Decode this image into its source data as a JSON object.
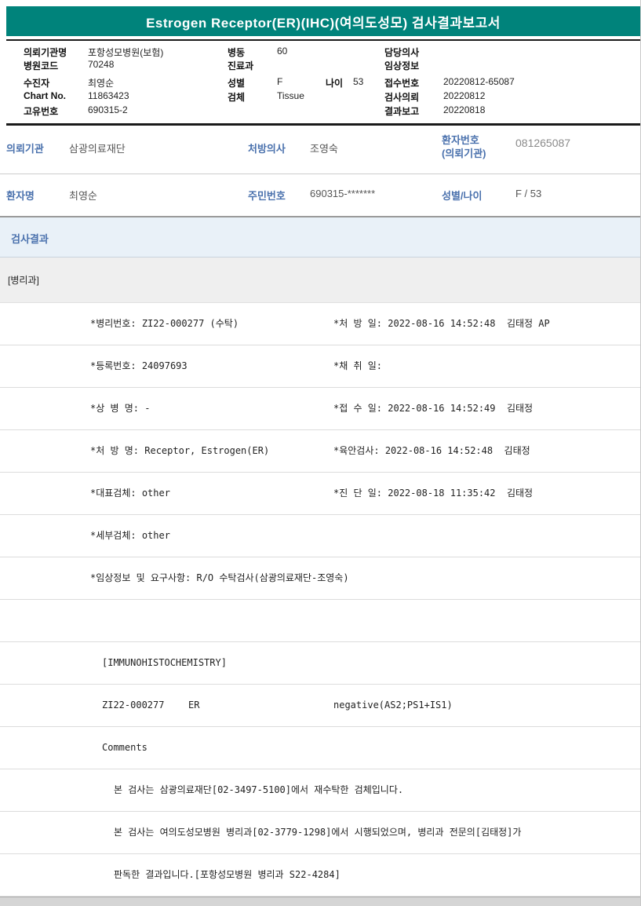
{
  "colors": {
    "banner_bg": "#00837B",
    "label_blue": "#4A71AD"
  },
  "banner": {
    "title": "Estrogen Receptor(ER)(IHC)(여의도성모) 검사결과보고서"
  },
  "info_box": {
    "col1": [
      {
        "label": "의뢰기관명",
        "value": "포항성모병원(보험)"
      },
      {
        "label": "병원코드",
        "value": "70248"
      },
      {
        "label": "수진자",
        "value": "최영순"
      },
      {
        "label": "Chart No.",
        "value": "11863423"
      },
      {
        "label": "고유번호",
        "value": "690315-2"
      }
    ],
    "col2": [
      {
        "label": "병동",
        "value": "60"
      },
      {
        "label": "진료과",
        "value": ""
      },
      {
        "label": "성별",
        "value": "F"
      },
      {
        "label": "검체",
        "value": "Tissue"
      }
    ],
    "age": {
      "label": "나이",
      "value": "53"
    },
    "col3": [
      {
        "label": "담당의사",
        "value": ""
      },
      {
        "label": "임상정보",
        "value": ""
      },
      {
        "label": "접수번호",
        "value": "20220812-65087"
      },
      {
        "label": "검사의뢰",
        "value": "20220812"
      },
      {
        "label": "결과보고",
        "value": "20220818"
      }
    ]
  },
  "referral": {
    "row1": {
      "agency_label": "의뢰기관",
      "agency_value": "삼광의료재단",
      "doctor_label": "처방의사",
      "doctor_value": "조영숙",
      "patient_no_label_line1": "환자번호",
      "patient_no_label_line2": "(의뢰기관)",
      "patient_no_value": "081265087"
    },
    "row2": {
      "name_label": "환자명",
      "name_value": "최영순",
      "rrn_label": "주민번호",
      "rrn_value": "690315-*******",
      "sexage_label": "성별/나이",
      "sexage_value": "F / 53"
    }
  },
  "results": {
    "section_title": "검사결과",
    "department": "[병리과]",
    "rows": [
      {
        "left": "*병리번호: ZI22-000277 (수탁)",
        "right": "*처 방 일: 2022-08-16 14:52:48  김태정 AP"
      },
      {
        "left": "*등록번호: 24097693",
        "right": "*채 취 일:"
      },
      {
        "left": "*상 병 명: -",
        "right": "*접 수 일: 2022-08-16 14:52:49  김태정"
      },
      {
        "left": "*처 방 명: Receptor, Estrogen(ER)",
        "right": "*육안검사: 2022-08-16 14:52:48  김태정"
      },
      {
        "left": "*대표검체: other",
        "right": "*진 단 일: 2022-08-18 11:35:42  김태정"
      },
      {
        "left": "*세부검체: other",
        "right": ""
      },
      {
        "left": "*임상정보 및 요구사항: R/O 수탁검사(삼광의료재단-조영숙)",
        "right": ""
      },
      {
        "left": "",
        "right": ""
      },
      {
        "left": "[IMMUNOHISTOCHEMISTRY]",
        "right": ""
      },
      {
        "c1": "ZI22-000277",
        "c2": "ER",
        "c3": "negative(AS2;PS1+IS1)"
      },
      {
        "left": "Comments",
        "right": ""
      },
      {
        "left": "본 검사는 삼광의료재단[02-3497-5100]에서 재수탁한 검체입니다.",
        "right": ""
      },
      {
        "left": "본 검사는 여의도성모병원 병리과[02-3779-1298]에서 시행되었으며, 병리과 전문의[김태정]가",
        "right": ""
      },
      {
        "left": "판독한 결과입니다.[포항성모병원 병리과 S22-4284]",
        "right": ""
      }
    ]
  }
}
